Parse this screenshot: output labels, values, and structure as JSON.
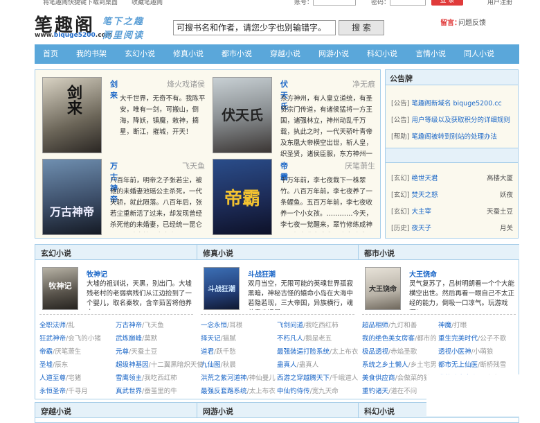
{
  "topbar": {
    "add_bookmark": "将笔趣阁快捷键下载到桌面",
    "favorite": "收藏笔趣阁",
    "account_label": "账号：",
    "password_label": "密码：",
    "login_button": "登 录",
    "register": "用户注册"
  },
  "header": {
    "logo_text": "笔趣阁",
    "url_prefix": "www.",
    "url_highlight": "biquge5200",
    "url_suffix": ".com",
    "slogan_line1": "笔下之趣",
    "slogan_line2": "阁里阅读",
    "search_value": "可搜书名和作者，请您少字也别输错字。",
    "search_button": "搜 索",
    "notice_label": "留言：",
    "notice_link": "问题反馈"
  },
  "nav": [
    "首页",
    "我的书架",
    "玄幻小说",
    "修真小说",
    "都市小说",
    "穿越小说",
    "网游小说",
    "科幻小说",
    "言情小说",
    "同人小说"
  ],
  "featured": [
    {
      "title": "剑来",
      "author": "烽火戏诸侯",
      "cover_text": "剑来",
      "desc": "大千世界，无奇不有。我陈平安，唯有一剑，可搬山，倒海，降妖，镇魔，敕神，摘星，断江，摧城，开天！"
    },
    {
      "title": "伏天氏",
      "author": "净无痕",
      "cover_text": "伏天氏",
      "desc": "东方神州，有人皇立道统，有圣贤宗门传道，有诸侯猛将一方王国，诸强林立，神州动乱千万载，执此之时，一代天骄叶青帝及东凰大帝横空出世，斩人皇，织圣贤，诸侯臣服，东方神州一统！"
    },
    {
      "title": "万古神帝",
      "author": "飞天鱼",
      "cover_text": "万古神帝",
      "desc": "八百年前，明帝之子张若尘，被他的未婚妻池瑶公主杀死，一代天骄，就此陨落。八百年后，张若尘重新活了过来，却发现曾经杀死他的未婚妻，已经统一昆仑界，开辟出第一中央帝国，号称“池瑶女"
    },
    {
      "title": "帝霸",
      "author": "厌笔萧生",
      "cover_text": "帝霸",
      "desc": "千万年前，李七夜栽下一株翠竹。八百万年前，李七夜养了一条鲤鱼。五百万年前，李七夜收养一个小女孩。…………今天，李七夜一觉醒来，翠竹修练成神灵，鲤鱼化作金龙，小女孩成"
    }
  ],
  "sidebar": {
    "announce_title": "公告牌",
    "announcements": [
      {
        "tag": "[公告]",
        "text": "笔趣阁新域名 biquge5200.cc"
      },
      {
        "tag": "[公告]",
        "text": "用户等级以及获取积分的详细规则"
      },
      {
        "tag": "[帮助]",
        "text": "笔趣阁被转到别站的处理办法"
      }
    ],
    "ranks": [
      {
        "tag": "[玄幻]",
        "name": "绝世天君",
        "author": "高楼大厦"
      },
      {
        "tag": "[玄幻]",
        "name": "焚天之怒",
        "author": "妖夜"
      },
      {
        "tag": "[玄幻]",
        "name": "大主宰",
        "author": "天蚕土豆"
      },
      {
        "tag": "[历史]",
        "name": "夜天子",
        "author": "月关"
      }
    ]
  },
  "categories": [
    {
      "title": "玄幻小说",
      "feature": {
        "title": "牧神记",
        "cover_text": "牧神记",
        "desc": "大墟的祖训说，天黑，别出门。大墟残老村的老弱病残们从江边捡到了一个婴儿，取名秦牧，含辛茹苦将他养大..."
      },
      "links": [
        {
          "name": "全职法师",
          "author": "乱"
        },
        {
          "name": "万古神帝",
          "author": "飞天鱼"
        },
        {
          "name": "狂武神帝",
          "author": "会飞的小猪"
        },
        {
          "name": "武炼巅峰",
          "author": "莫默"
        },
        {
          "name": "帝霸",
          "author": "厌笔萧生"
        },
        {
          "name": "元尊",
          "author": "天蚕土豆"
        },
        {
          "name": "圣墟",
          "author": "辰东"
        },
        {
          "name": "超级神基因",
          "author": "十二翼黑暗炽天使"
        },
        {
          "name": "人道至尊",
          "author": "宅猪"
        },
        {
          "name": "雪鹰领主",
          "author": "我吃西红柿"
        },
        {
          "name": "永恒圣帝",
          "author": "千寻月"
        },
        {
          "name": "真武世界",
          "author": "蚕茧里的牛"
        }
      ]
    },
    {
      "title": "修真小说",
      "feature": {
        "title": "斗战狂潮",
        "cover_text": "斗战狂潮",
        "desc": "双月当空，无限可能的英魂世界孤寂黑暗，神秘古怪的嬉命小岛在大海中若隐若现，三大帝国，异族横行，魂兽霸幽远是..."
      },
      "links": [
        {
          "name": "一念永恒",
          "author": "耳根"
        },
        {
          "name": "飞剑问道",
          "author": "我吃西红柿"
        },
        {
          "name": "择天记",
          "author": "猫腻"
        },
        {
          "name": "不朽凡人",
          "author": "鹅是老五"
        },
        {
          "name": "道君",
          "author": "跃千愁"
        },
        {
          "name": "最强装逼打脸系统",
          "author": "太上布衣"
        },
        {
          "name": "九仙图",
          "author": "秋晨"
        },
        {
          "name": "蛊真人",
          "author": "蛊真人"
        },
        {
          "name": "洪荒之紫河道神",
          "author": "神仙曼儿"
        },
        {
          "name": "西游之穿越腾天下",
          "author": "千峨道人"
        },
        {
          "name": "最强反套路系统",
          "author": "太上布衣"
        },
        {
          "name": "中仙钓侍传",
          "author": "宽九天命"
        }
      ]
    },
    {
      "title": "都市小说",
      "feature": {
        "title": "大王饶命",
        "cover_text": "大王饶命",
        "desc": "灵气复苏了，吕树明朗看一个个大能横空出世。然后再看一眼自己不太正经的能力，倒吸一口凉气。玩游戏啊！..."
      },
      "links": [
        {
          "name": "超品相师",
          "author": "九灯和善"
        },
        {
          "name": "神魔",
          "author": "打眼"
        },
        {
          "name": "我的绝色美女房客",
          "author": "都市的"
        },
        {
          "name": "重生完美时代",
          "author": "公子不歌"
        },
        {
          "name": "极品透视",
          "author": "赤焰圣歌"
        },
        {
          "name": "透视小医神",
          "author": "小萌狼"
        },
        {
          "name": "系统之乡土懒人",
          "author": "乡土宅男"
        },
        {
          "name": "都市无上仙医",
          "author": "断桥残雪"
        },
        {
          "name": "美食供应商",
          "author": "会做菜的猫"
        },
        {
          "name": "我的贴身女上司",
          "author": "冬冬"
        },
        {
          "name": "重钓诸天",
          "author": "道在不问"
        },
        {
          "name": "",
          "author": ""
        }
      ]
    }
  ],
  "bottom_categories": [
    "穿越小说",
    "网游小说",
    "科幻小说"
  ]
}
